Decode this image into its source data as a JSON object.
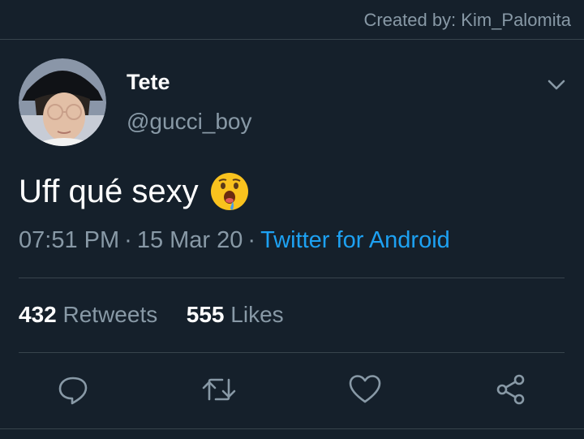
{
  "credit": "Created by: Kim_Palomita",
  "tweet": {
    "display_name": "Tete",
    "handle": "@gucci_boy",
    "text": "Uff qué sexy",
    "emoji": "drooling-face",
    "time": "07:51 PM",
    "date": "15 Mar 20",
    "separator": "·",
    "source": "Twitter for Android"
  },
  "stats": {
    "retweets_count": "432",
    "retweets_label": "Retweets",
    "likes_count": "555",
    "likes_label": "Likes"
  },
  "actions": [
    "reply-icon",
    "retweet-icon",
    "like-icon",
    "share-icon"
  ],
  "colors": {
    "background": "#15202b",
    "secondary_text": "#8899a6",
    "link": "#1da1f2",
    "divider": "#38444d"
  }
}
